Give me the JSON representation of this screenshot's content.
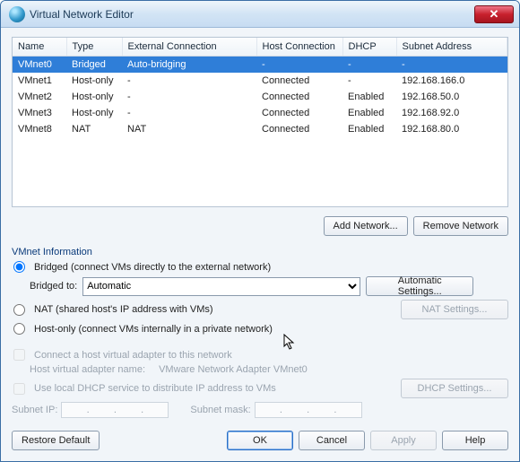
{
  "window": {
    "title": "Virtual Network Editor"
  },
  "table": {
    "headers": [
      "Name",
      "Type",
      "External Connection",
      "Host Connection",
      "DHCP",
      "Subnet Address"
    ],
    "rows": [
      {
        "name": "VMnet0",
        "type": "Bridged",
        "ext": "Auto-bridging",
        "host": "-",
        "dhcp": "-",
        "subnet": "-",
        "selected": true
      },
      {
        "name": "VMnet1",
        "type": "Host-only",
        "ext": "-",
        "host": "Connected",
        "dhcp": "-",
        "subnet": "192.168.166.0",
        "selected": false
      },
      {
        "name": "VMnet2",
        "type": "Host-only",
        "ext": "-",
        "host": "Connected",
        "dhcp": "Enabled",
        "subnet": "192.168.50.0",
        "selected": false
      },
      {
        "name": "VMnet3",
        "type": "Host-only",
        "ext": "-",
        "host": "Connected",
        "dhcp": "Enabled",
        "subnet": "192.168.92.0",
        "selected": false
      },
      {
        "name": "VMnet8",
        "type": "NAT",
        "ext": "NAT",
        "host": "Connected",
        "dhcp": "Enabled",
        "subnet": "192.168.80.0",
        "selected": false
      }
    ]
  },
  "buttons": {
    "add_network": "Add Network...",
    "remove_network": "Remove Network",
    "automatic_settings": "Automatic Settings...",
    "nat_settings": "NAT Settings...",
    "dhcp_settings": "DHCP Settings...",
    "restore_default": "Restore Default",
    "ok": "OK",
    "cancel": "Cancel",
    "apply": "Apply",
    "help": "Help"
  },
  "info": {
    "title": "VMnet Information",
    "bridged_label": "Bridged (connect VMs directly to the external network)",
    "bridged_to_label": "Bridged to:",
    "bridged_to_value": "Automatic",
    "nat_label": "NAT (shared host's IP address with VMs)",
    "hostonly_label": "Host-only (connect VMs internally in a private network)",
    "connect_adapter_label": "Connect a host virtual adapter to this network",
    "host_adapter_name_label": "Host virtual adapter name:",
    "host_adapter_name_value": "VMware Network Adapter VMnet0",
    "dhcp_label": "Use local DHCP service to distribute IP address to VMs",
    "subnet_ip_label": "Subnet IP:",
    "subnet_mask_label": "Subnet mask:"
  }
}
